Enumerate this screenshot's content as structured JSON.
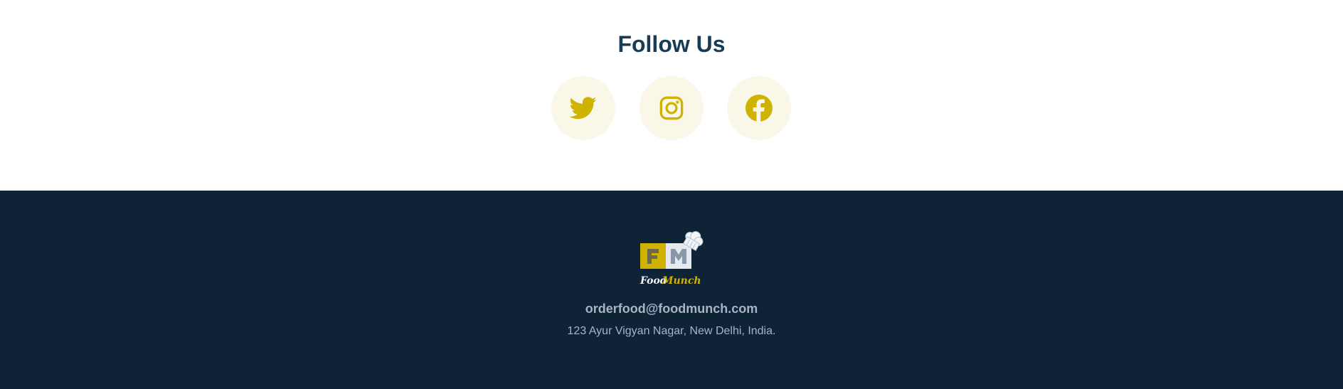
{
  "follow": {
    "title": "Follow Us",
    "icon_color": "#d0b200",
    "circle_bg": "#faf7e8",
    "title_color": "#183b56",
    "social_links": [
      {
        "name": "twitter",
        "icon": "twitter-icon"
      },
      {
        "name": "instagram",
        "icon": "instagram-icon"
      },
      {
        "name": "facebook",
        "icon": "facebook-icon"
      }
    ]
  },
  "footer": {
    "background": "#0f2337",
    "logo": {
      "letters": "FM",
      "text_food": "Food",
      "text_munch": "Munch",
      "icon": "chef-hat-icon"
    },
    "email": "orderfood@foodmunch.com",
    "address": "123 Ayur Vigyan Nagar, New Delhi, India."
  }
}
